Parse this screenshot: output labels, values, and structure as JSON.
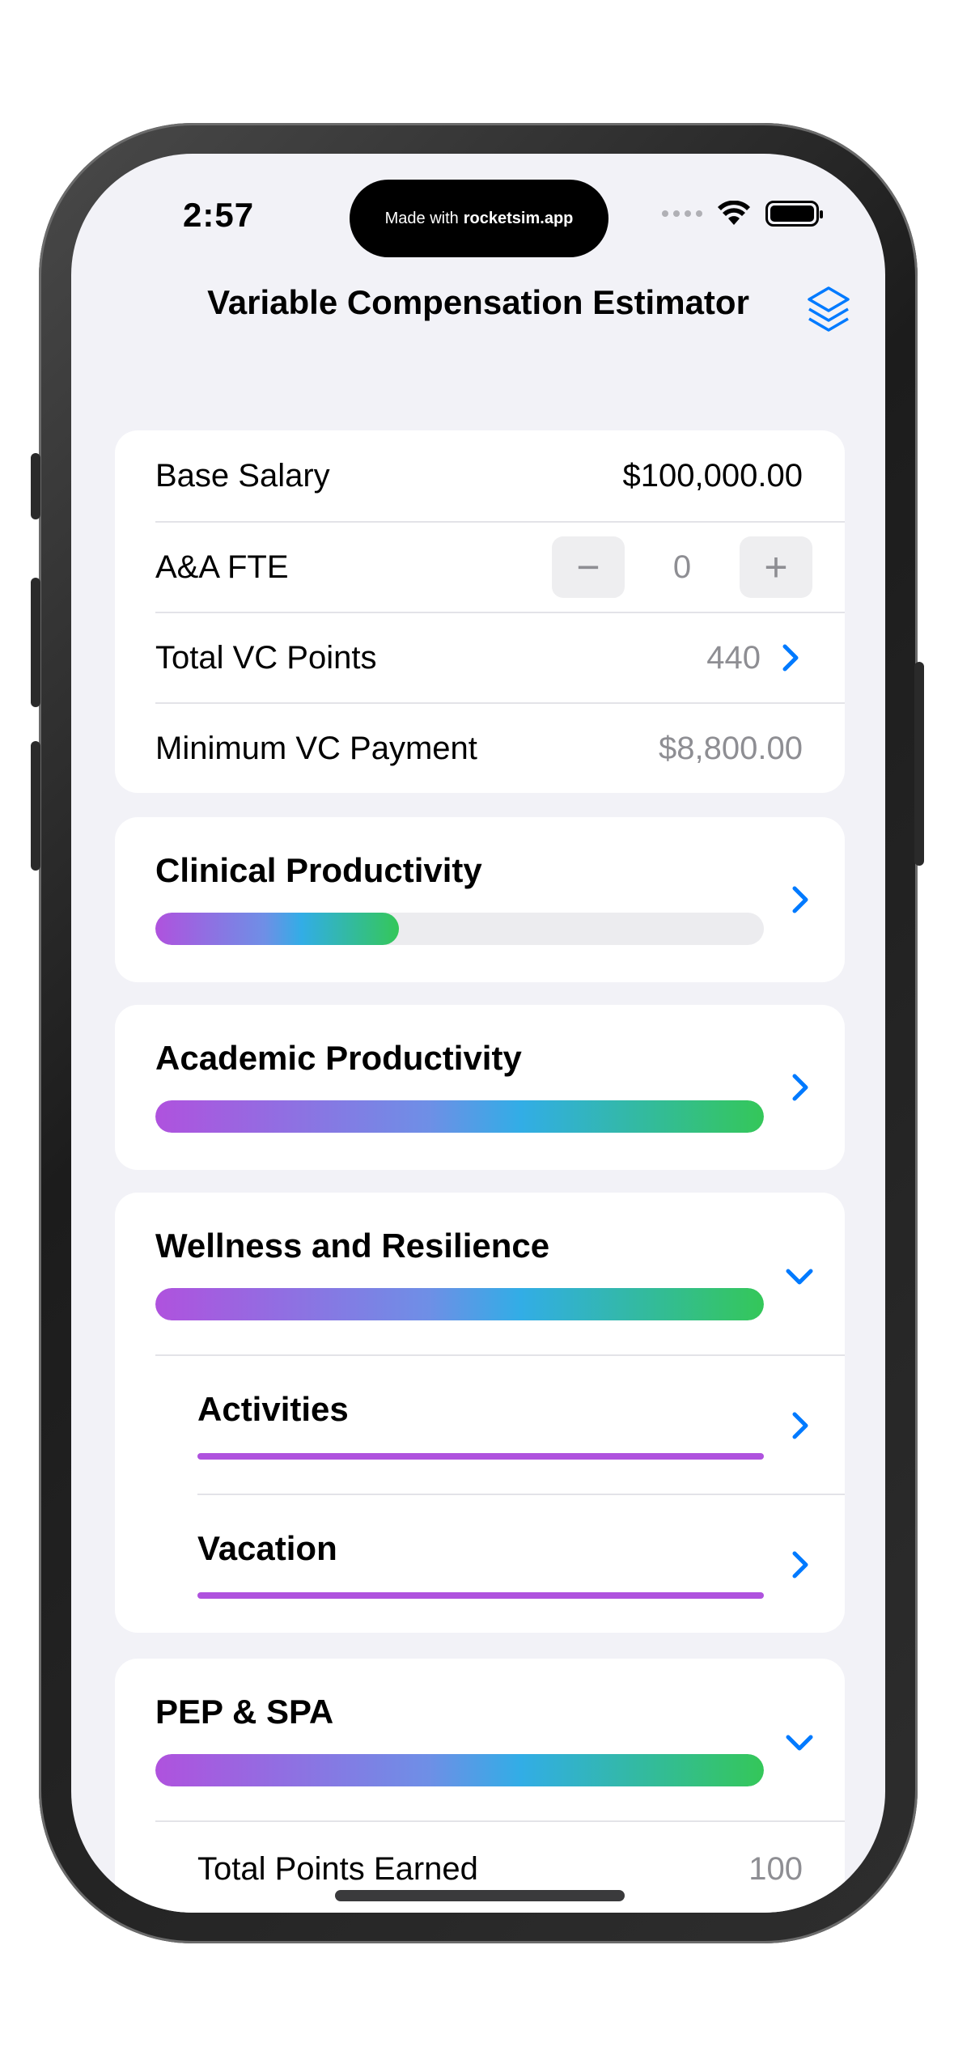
{
  "status_bar": {
    "time": "2:57",
    "island_prefix": "Made with",
    "island_brand": "rocketsim.app"
  },
  "nav": {
    "title": "Variable Compensation Estimator",
    "layers_icon": "square-stack-icon"
  },
  "summary": {
    "base_salary_label": "Base Salary",
    "base_salary_value": "$100,000.00",
    "fte_label": "A&A FTE",
    "fte_value": "0",
    "fte_minus": "−",
    "fte_plus": "+",
    "total_points_label": "Total VC Points",
    "total_points_value": "440",
    "min_payment_label": "Minimum VC Payment",
    "min_payment_value": "$8,800.00"
  },
  "sections": {
    "clinical": {
      "title": "Clinical Productivity",
      "progress": 0.4
    },
    "academic": {
      "title": "Academic Productivity",
      "progress": 1.0
    },
    "wellness": {
      "title": "Wellness and Resilience",
      "progress": 1.0,
      "items": [
        {
          "title": "Activities",
          "progress": 1.0
        },
        {
          "title": "Vacation",
          "progress": 1.0
        }
      ]
    },
    "pep": {
      "title": "PEP & SPA",
      "progress": 1.0,
      "total_points_label": "Total Points Earned",
      "total_points_value": "100"
    }
  },
  "colors": {
    "accent": "#007aff",
    "purple": "#af52de",
    "green": "#34c759",
    "teal": "#32ade6"
  }
}
